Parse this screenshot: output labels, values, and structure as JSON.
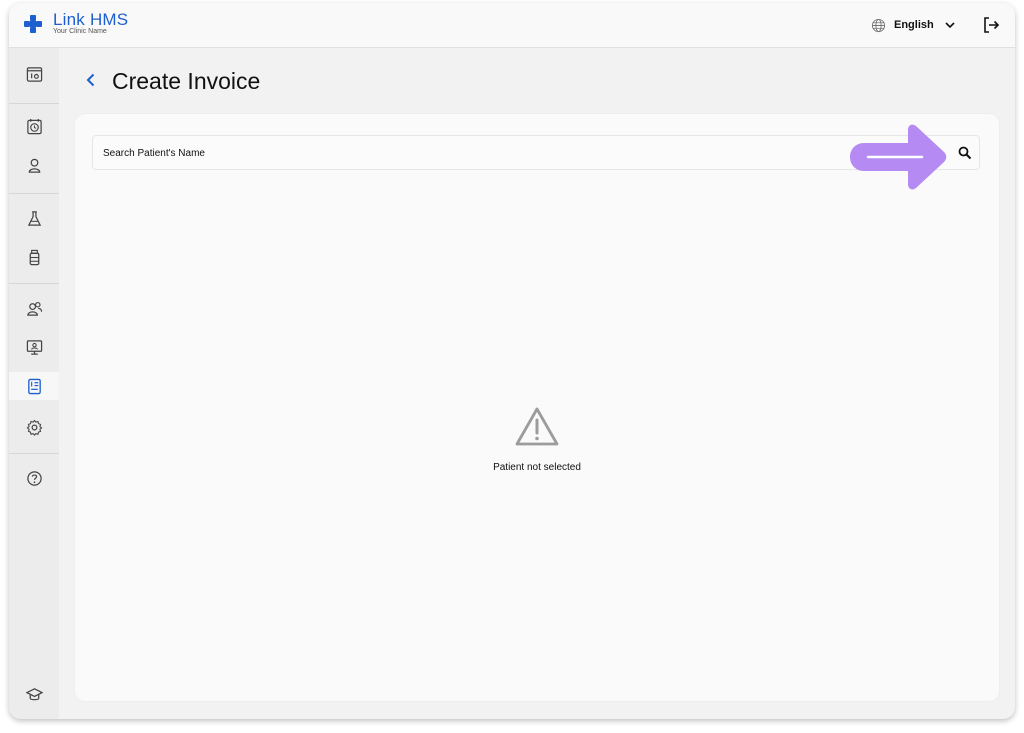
{
  "app": {
    "brand_name": "Link HMS",
    "brand_name_part1": "Link",
    "brand_name_part2": "HMS",
    "clinic_name": "Your Clinic Name",
    "brand_color": "#1d5fd0"
  },
  "header": {
    "language": "English",
    "language_icon": "globe-icon",
    "logout_icon": "logout-icon"
  },
  "sidebar": {
    "items": [
      {
        "name": "dashboard",
        "icon": "dashboard-icon"
      },
      {
        "name": "appointments",
        "icon": "clock-icon"
      },
      {
        "name": "patients",
        "icon": "user-icon"
      },
      {
        "name": "lab",
        "icon": "flask-icon"
      },
      {
        "name": "pharmacy",
        "icon": "bottle-icon"
      },
      {
        "name": "staff",
        "icon": "users-icon"
      },
      {
        "name": "telemedicine",
        "icon": "monitor-icon"
      },
      {
        "name": "invoices",
        "icon": "invoice-icon",
        "active": true
      },
      {
        "name": "settings",
        "icon": "gear-icon"
      },
      {
        "name": "help",
        "icon": "help-icon"
      },
      {
        "name": "training",
        "icon": "graduation-cap-icon"
      }
    ],
    "active_color": "#1d5fd0"
  },
  "page": {
    "title": "Create Invoice",
    "back_icon": "chevron-left-icon"
  },
  "search": {
    "placeholder": "Search Patient's Name",
    "value": "",
    "icon": "search-icon",
    "highlight_color": "#b58af2"
  },
  "empty_state": {
    "icon": "warning-icon",
    "message": "Patient not selected"
  }
}
